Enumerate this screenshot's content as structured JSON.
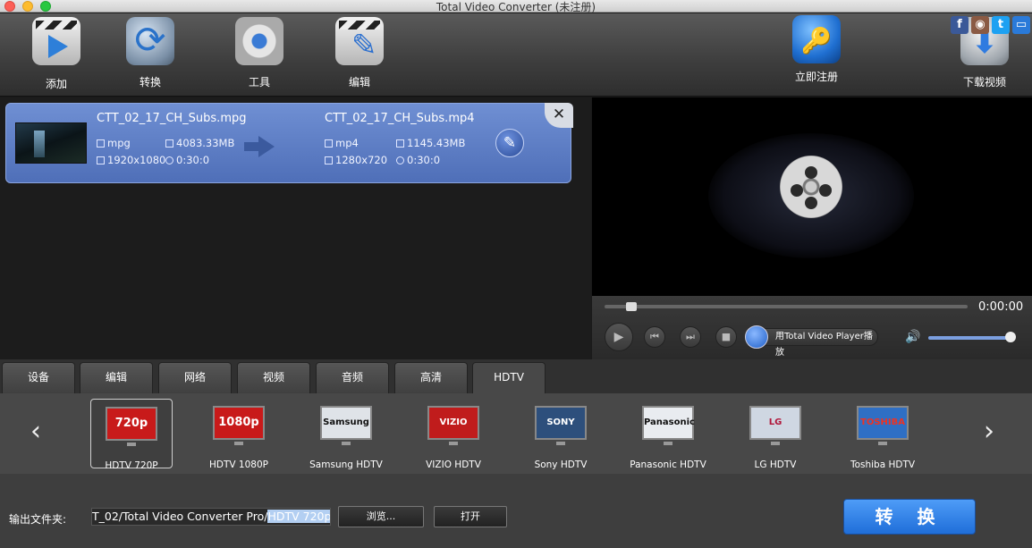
{
  "window": {
    "title": "Total Video Converter (未注册)"
  },
  "toolbar": {
    "add": "添加",
    "convert": "转换",
    "tools": "工具",
    "edit": "编辑",
    "register": "立即注册",
    "download": "下载视频"
  },
  "social": {
    "facebook": "f",
    "twitter": "t"
  },
  "file": {
    "source": {
      "name": "CTT_02_17_CH_Subs.mpg",
      "format": "mpg",
      "size": "4083.33MB",
      "resolution": "1920x1080",
      "duration": "0:30:0"
    },
    "target": {
      "name": "CTT_02_17_CH_Subs.mp4",
      "format": "mp4",
      "size": "1145.43MB",
      "resolution": "1280x720",
      "duration": "0:30:0"
    }
  },
  "player": {
    "time": "0:00:00",
    "player_label": "用Total Video Player播放"
  },
  "tabs": [
    "设备",
    "编辑",
    "网络",
    "视频",
    "音频",
    "高清",
    "HDTV"
  ],
  "devices": [
    {
      "label": "HDTV 720P",
      "screen": "720p"
    },
    {
      "label": "HDTV 1080P",
      "screen": "1080p"
    },
    {
      "label": "Samsung HDTV",
      "screen": "Samsung"
    },
    {
      "label": "VIZIO HDTV",
      "screen": "VIZIO"
    },
    {
      "label": "Sony HDTV",
      "screen": "SONY"
    },
    {
      "label": "Panasonic HDTV",
      "screen": "Panasonic"
    },
    {
      "label": "LG HDTV",
      "screen": "LG"
    },
    {
      "label": "Toshiba HDTV",
      "screen": "TOSHIBA"
    }
  ],
  "output": {
    "label": "输出文件夹:",
    "path_prefix": "T_02/Total Video Converter Pro/",
    "path_selected": "HDTV 720p",
    "browse": "浏览...",
    "open": "打开",
    "convert": "转 换"
  },
  "colors": {
    "accent": "#1f6ed9",
    "card": "#5b7cc4"
  }
}
